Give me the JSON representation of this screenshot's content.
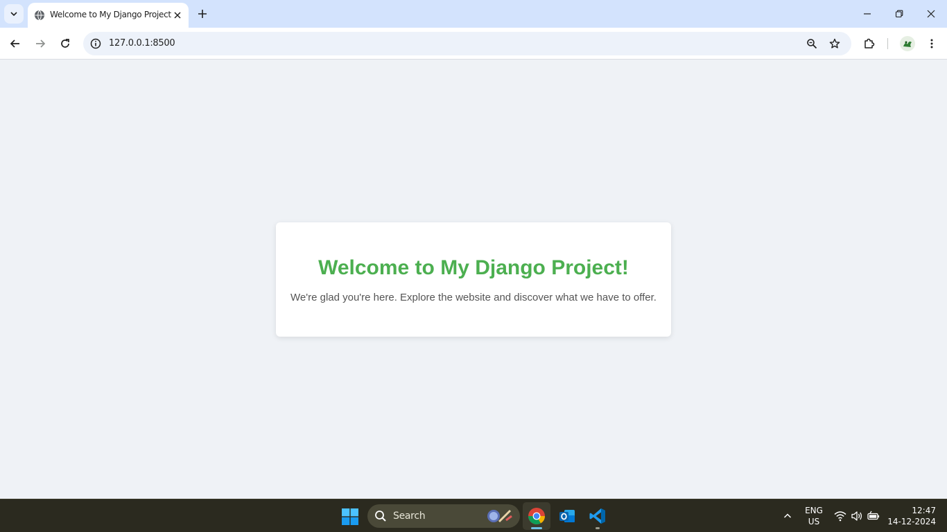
{
  "browser": {
    "tab": {
      "title": "Welcome to My Django Project"
    },
    "url": "127.0.0.1:8500"
  },
  "page": {
    "heading": "Welcome to My Django Project!",
    "message": "We're glad you're here. Explore the website and discover what we have to offer.",
    "accent_color": "#4caf50",
    "background_color": "#eff2f6"
  },
  "taskbar": {
    "search_label": "Search",
    "apps": [
      "chrome-icon",
      "outlook-icon",
      "vscode-icon"
    ],
    "language": {
      "line1": "ENG",
      "line2": "US"
    },
    "clock": {
      "time": "12:47",
      "date": "14-12-2024"
    }
  }
}
